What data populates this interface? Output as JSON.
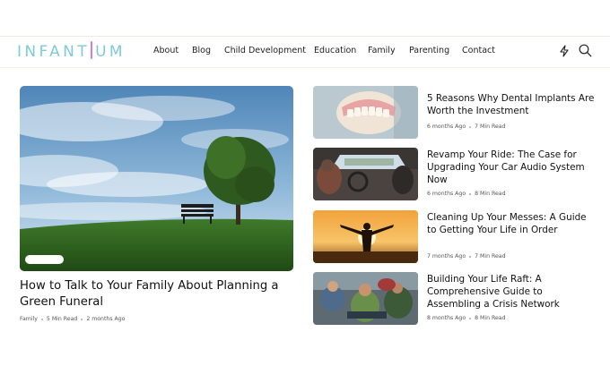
{
  "site": {
    "logo_before": "INFANT",
    "logo_after": "UM"
  },
  "nav": {
    "items": [
      "About",
      "Blog",
      "Child Development",
      "Education",
      "Family",
      "Parenting",
      "Contact"
    ]
  },
  "header_icons": [
    "lightning-icon",
    "search-icon"
  ],
  "featured": {
    "title": "How to Talk to Your Family About Planning a Green Funeral",
    "category": "Family",
    "read_time": "5 Min Read",
    "date": "2 months Ago"
  },
  "articles": [
    {
      "title": "5 Reasons Why Dental Implants Are Worth the Investment",
      "date": "6 months Ago",
      "read_time": "7 Min Read"
    },
    {
      "title": "Revamp Your Ride: The Case for Upgrading Your Car Audio System Now",
      "date": "6 months Ago",
      "read_time": "8 Min Read"
    },
    {
      "title": "Cleaning Up Your Messes: A Guide to Getting Your Life in Order",
      "date": "7 months Ago",
      "read_time": "7 Min Read"
    },
    {
      "title": "Building Your Life Raft: A Comprehensive Guide to Assembling a Crisis Network",
      "date": "8 months Ago",
      "read_time": "8 Min Read"
    }
  ],
  "colors": {
    "logo": "#7ecbd6",
    "logo_accent": "#d77ad8",
    "text": "#111111"
  }
}
